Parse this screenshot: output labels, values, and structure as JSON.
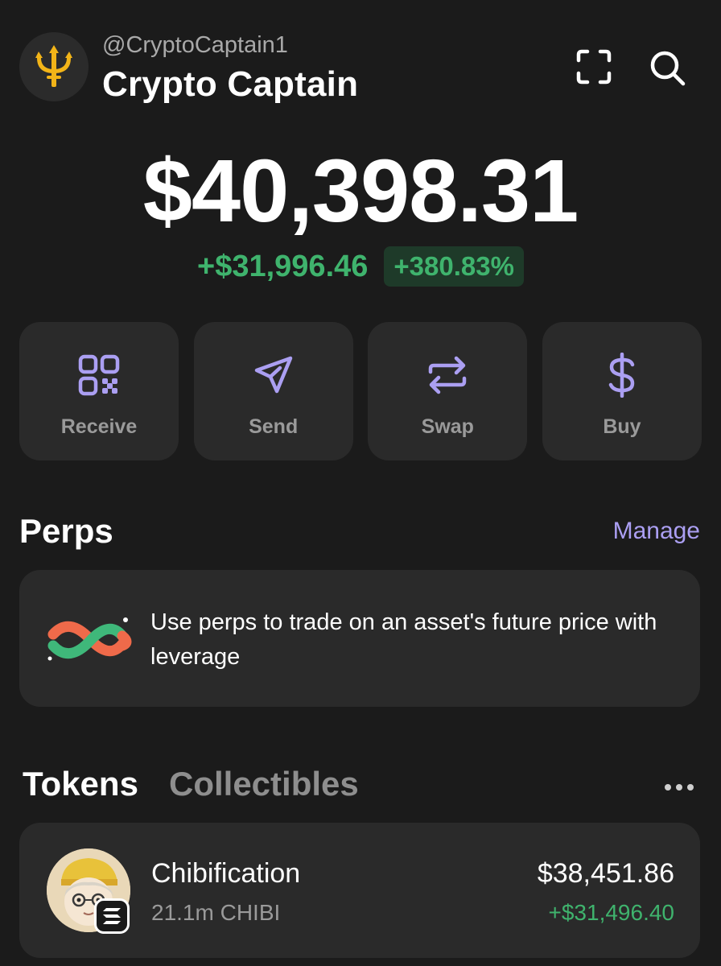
{
  "colors": {
    "background": "#1b1b1b",
    "card": "#2a2a2a",
    "accent_purple": "#ab9ff2",
    "positive_green": "#3fb36d",
    "muted_text": "#9a9a9a"
  },
  "header": {
    "handle": "@CryptoCaptain1",
    "account_name": "Crypto Captain",
    "avatar_icon": "trident-icon",
    "scan_icon": "scan-icon",
    "search_icon": "search-icon"
  },
  "portfolio": {
    "balance": "$40,398.31",
    "change_amount": "+$31,996.46",
    "change_percent": "+380.83%"
  },
  "actions": [
    {
      "label": "Receive",
      "icon": "qr-code-icon"
    },
    {
      "label": "Send",
      "icon": "send-icon"
    },
    {
      "label": "Swap",
      "icon": "swap-icon"
    },
    {
      "label": "Buy",
      "icon": "dollar-icon"
    }
  ],
  "perps": {
    "title": "Perps",
    "manage_label": "Manage",
    "description": "Use perps to trade on an asset's future price with leverage",
    "icon": "perps-infinity-icon"
  },
  "tabs": {
    "tokens": "Tokens",
    "collectibles": "Collectibles",
    "more_icon": "more-icon"
  },
  "tokens": [
    {
      "name": "Chibification",
      "quantity": "21.1m CHIBI",
      "value": "$38,451.86",
      "change": "+$31,496.40",
      "chain_icon": "solana-icon"
    }
  ]
}
